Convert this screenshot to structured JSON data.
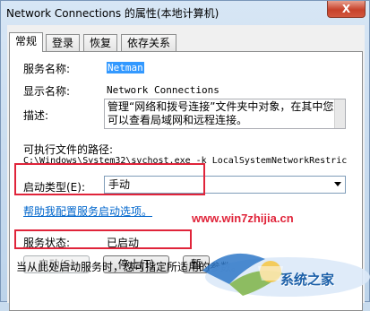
{
  "window": {
    "title": "Network Connections 的属性(本地计算机)",
    "close_glyph": "X"
  },
  "tabs": [
    {
      "label": "常规",
      "active": true
    },
    {
      "label": "登录",
      "active": false
    },
    {
      "label": "恢复",
      "active": false
    },
    {
      "label": "依存关系",
      "active": false
    }
  ],
  "general": {
    "service_name_label": "服务名称:",
    "service_name_value": "Netman",
    "display_name_label": "显示名称:",
    "display_name_value": "Network Connections",
    "description_label": "描述:",
    "description_value": "管理“网络和拨号连接”文件夹中对象，在其中您可以查看局域网和远程连接。",
    "exe_path_label": "可执行文件的路径:",
    "exe_path_value": "C:\\Windows\\System32\\svchost.exe -k LocalSystemNetworkRestric",
    "startup_type_label": "启动类型(E):",
    "startup_type_value": "手动",
    "help_link": "帮助我配置服务启动选项。",
    "service_status_label": "服务状态:",
    "service_status_value": "已启动",
    "bottom_hint": "当从此处启动服务时，您可指定所适用的参数。"
  },
  "buttons": {
    "start": "启动(S)",
    "stop": "停止(T)",
    "pause": "暂"
  },
  "overlay": {
    "url": "www.win7zhijia.cn",
    "logo_text": "系统之家"
  },
  "colors": {
    "highlight_box": "#e0243a",
    "link": "#0066cc",
    "selection": "#3399ff"
  }
}
